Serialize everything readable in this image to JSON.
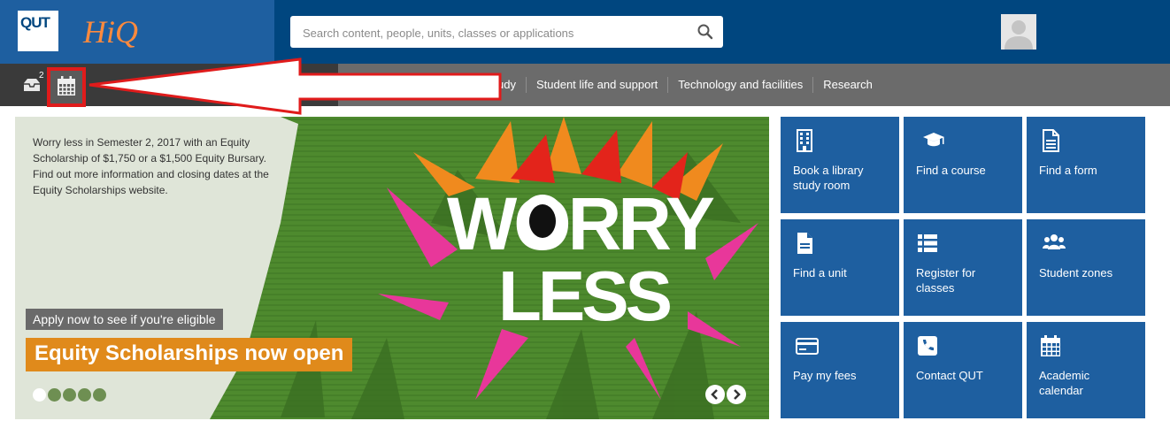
{
  "header": {
    "qut_logo": "QUT",
    "hiq_logo": "HiQ",
    "search": {
      "placeholder": "Search content, people, units, classes or applications",
      "value": ""
    }
  },
  "toolbar": {
    "inbox_count": "2",
    "nav": [
      "udy",
      "Student life and support",
      "Technology and facilities",
      "Research"
    ]
  },
  "banner": {
    "text": "Worry less in Semester 2, 2017 with an Equity Scholarship of $1,750 or a $1,500 Equity Bursary. Find out more information and closing dates at the Equity Scholarships website.",
    "artwork_line1": "WORRY",
    "artwork_line2": "LESS",
    "apply": "Apply now to see if you're eligible",
    "headline": "Equity Scholarships now open",
    "slides": 5,
    "active_slide": 1
  },
  "tiles": [
    {
      "label": "Book a library study room",
      "icon": "building-icon"
    },
    {
      "label": "Find a course",
      "icon": "graduation-cap-icon"
    },
    {
      "label": "Find a form",
      "icon": "form-icon"
    },
    {
      "label": "Find a unit",
      "icon": "document-icon"
    },
    {
      "label": "Register for classes",
      "icon": "list-icon"
    },
    {
      "label": "Student zones",
      "icon": "users-icon"
    },
    {
      "label": "Pay my fees",
      "icon": "credit-card-icon"
    },
    {
      "label": "Contact QUT",
      "icon": "phone-icon"
    },
    {
      "label": "Academic calendar",
      "icon": "calendar-icon"
    }
  ],
  "colors": {
    "header": "#00467f",
    "tile": "#1e5fa0",
    "navbar": "#6b6b6b",
    "accent": "#e08a1b",
    "highlight": "#e01b1b"
  }
}
